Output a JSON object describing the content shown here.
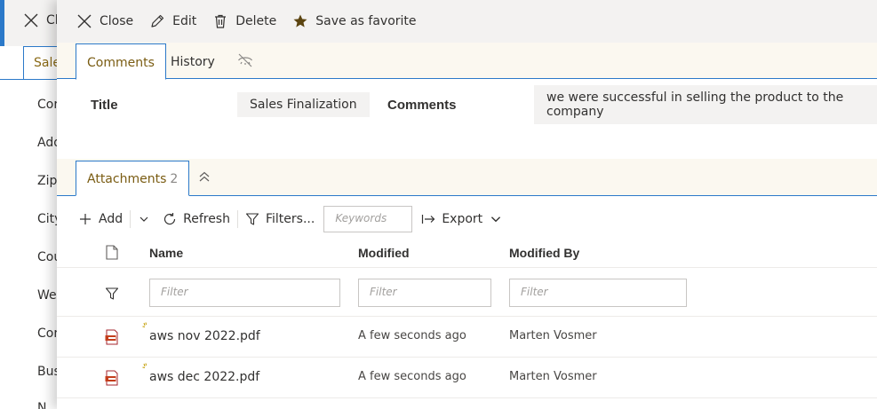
{
  "background": {
    "close_label": "Cl",
    "tab_label": "Sale",
    "fields": [
      "Cor",
      "Add",
      "Zip",
      "City",
      "Cou",
      "We",
      "Cor",
      "Bus",
      "N"
    ]
  },
  "toolbar": {
    "close_label": "Close",
    "edit_label": "Edit",
    "delete_label": "Delete",
    "favorite_label": "Save as favorite"
  },
  "tabs": [
    {
      "label": "Comments",
      "active": true
    },
    {
      "label": "History",
      "active": false
    }
  ],
  "form": {
    "title_label": "Title",
    "title_value": "Sales Finalization",
    "comments_label": "Comments",
    "comments_value": "we were successful in selling the product to the company"
  },
  "attachments": {
    "tab_label": "Attachments",
    "count": "2",
    "commands": {
      "add": "Add",
      "refresh": "Refresh",
      "filters": "Filters...",
      "keywords_placeholder": "Keywords",
      "export": "Export"
    },
    "columns": {
      "name": "Name",
      "modified": "Modified",
      "modified_by": "Modified By"
    },
    "filter_placeholder": "Filter",
    "rows": [
      {
        "name": "aws nov 2022.pdf",
        "modified": "A few seconds ago",
        "modified_by": "Marten Vosmer"
      },
      {
        "name": "aws dec 2022.pdf",
        "modified": "A few seconds ago",
        "modified_by": "Marten Vosmer"
      }
    ]
  },
  "colors": {
    "accent_blue": "#2b79c9",
    "tab_text_gold": "#7a5c12",
    "pdf_red": "#c43e1c"
  }
}
